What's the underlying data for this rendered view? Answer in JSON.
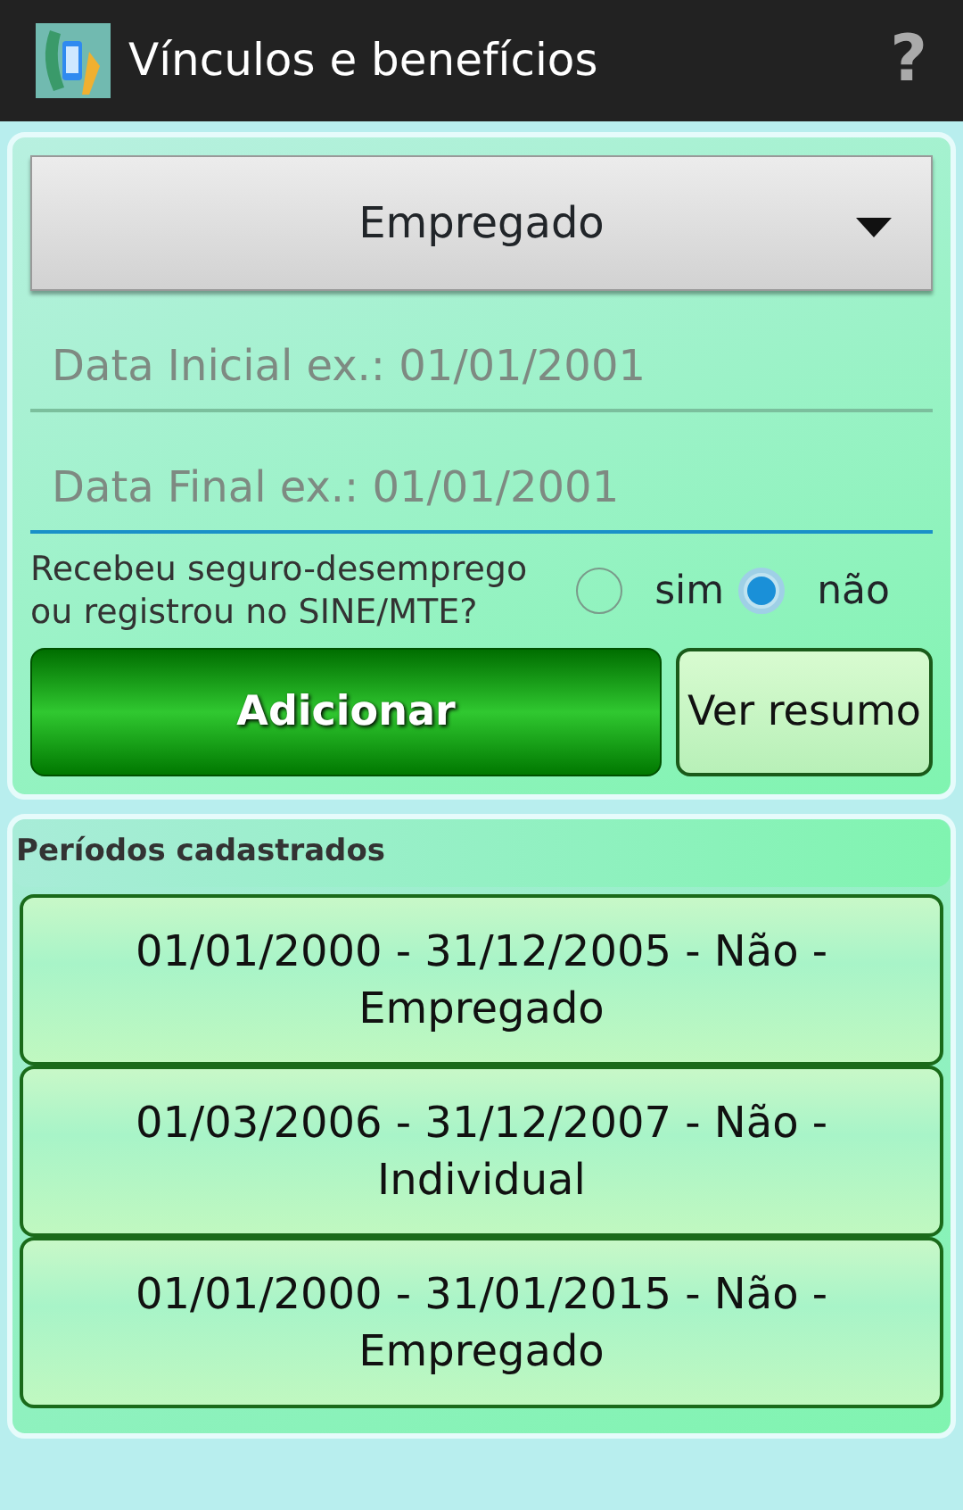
{
  "action_bar": {
    "title": "Vínculos e benefícios",
    "help": "?"
  },
  "spinner": {
    "value": "Empregado"
  },
  "fields": [
    {
      "placeholder": "Data Inicial ex.: 01/01/2001",
      "focused": false
    },
    {
      "placeholder": "Data Final ex.: 01/01/2001",
      "focused": true
    }
  ],
  "question": {
    "label": "Recebeu seguro-desemprego\nou registrou no SINE/MTE?",
    "options": [
      {
        "label": "sim",
        "selected": false
      },
      {
        "label": "não",
        "selected": true
      }
    ]
  },
  "buttons": [
    {
      "kind": "primary",
      "label": "Adicionar"
    },
    {
      "kind": "secondary",
      "label": "Ver resumo"
    }
  ],
  "periods": {
    "title": "Períodos cadastrados",
    "items": [
      {
        "text": "01/01/2000 - 31/12/2005 - Não - Empregado"
      },
      {
        "text": "01/03/2006 - 31/12/2007 - Não - Individual"
      },
      {
        "text": "01/01/2000 - 31/01/2015 - Não - Empregado"
      }
    ]
  }
}
